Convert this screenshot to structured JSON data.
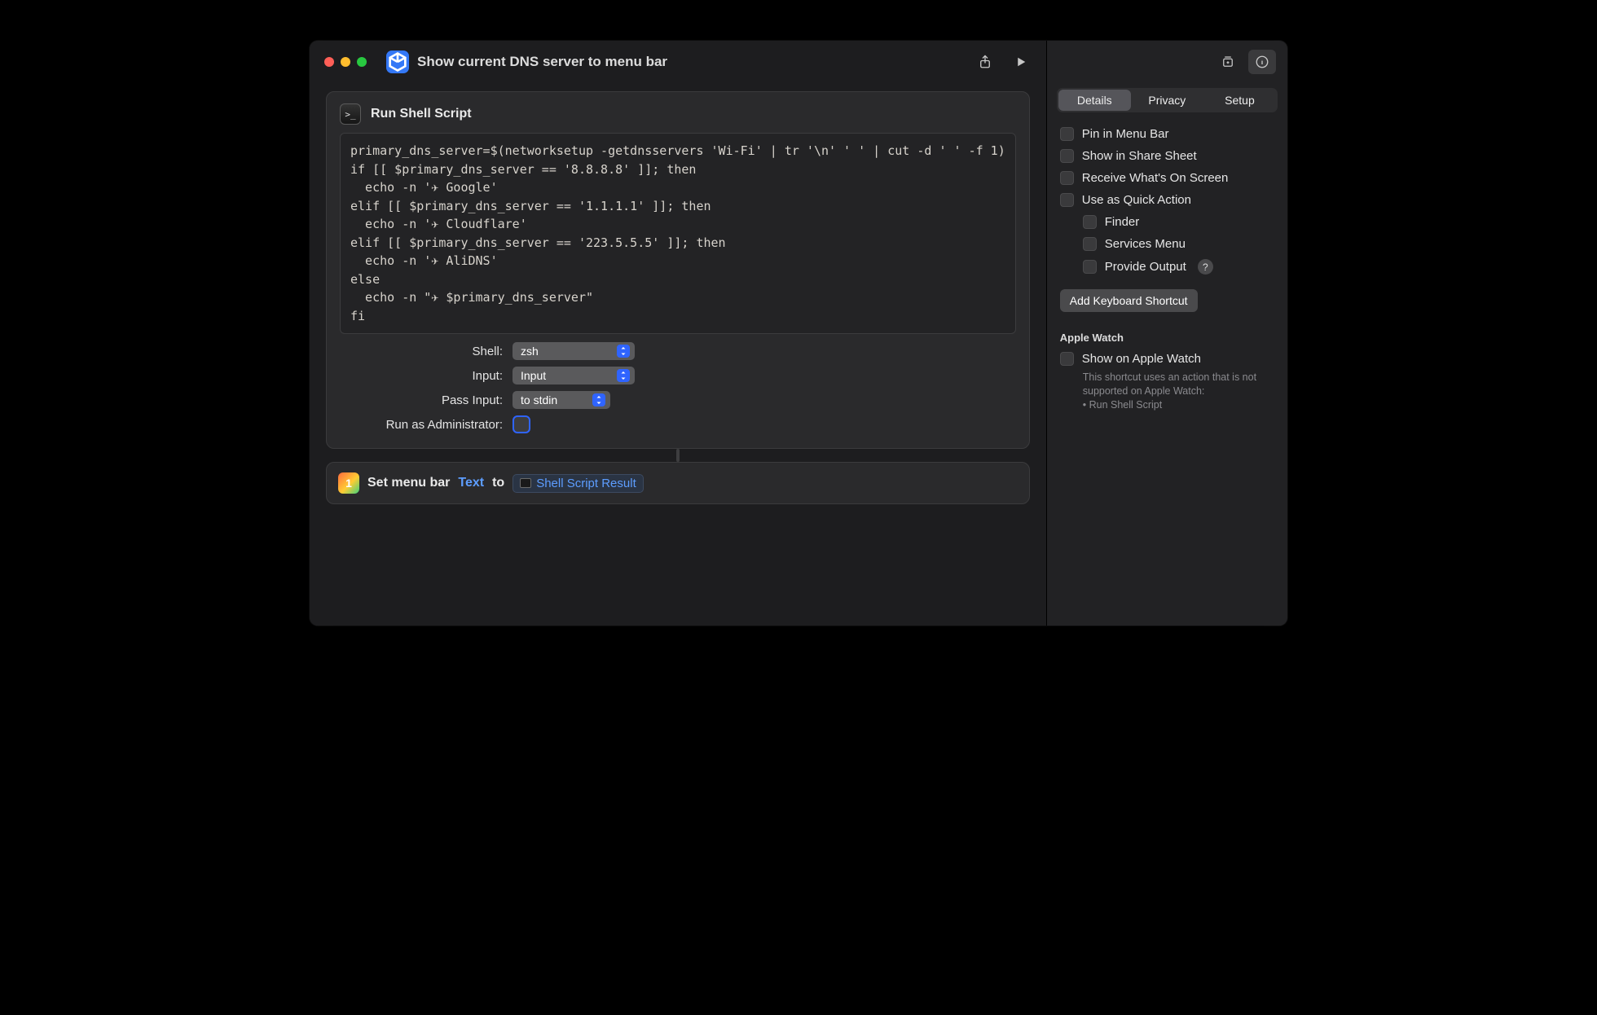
{
  "header": {
    "title": "Show current DNS server to menu bar"
  },
  "actions": {
    "shell": {
      "title": "Run Shell Script",
      "code": "primary_dns_server=$(networksetup -getdnsservers 'Wi-Fi' | tr '\\n' ' ' | cut -d ' ' -f 1)\nif [[ $primary_dns_server == '8.8.8.8' ]]; then\n  echo -n '✈ Google'\nelif [[ $primary_dns_server == '1.1.1.1' ]]; then\n  echo -n '✈ Cloudflare'\nelif [[ $primary_dns_server == '223.5.5.5' ]]; then\n  echo -n '✈ AliDNS'\nelse\n  echo -n \"✈ $primary_dns_server\"\nfi",
      "params": {
        "shell_label": "Shell:",
        "shell_value": "zsh",
        "input_label": "Input:",
        "input_value": "Input",
        "pass_label": "Pass Input:",
        "pass_value": "to stdin",
        "admin_label": "Run as Administrator:"
      }
    },
    "menubar": {
      "title": "Set menu bar",
      "token1": "Text",
      "to": "to",
      "token2": "Shell Script Result",
      "icon_glyph": "1"
    }
  },
  "sidebar": {
    "tabs": {
      "details": "Details",
      "privacy": "Privacy",
      "setup": "Setup"
    },
    "checks": {
      "pin": "Pin in Menu Bar",
      "share": "Show in Share Sheet",
      "receive": "Receive What's On Screen",
      "quick": "Use as Quick Action",
      "finder": "Finder",
      "services": "Services Menu",
      "provide": "Provide Output"
    },
    "add_shortcut": "Add Keyboard Shortcut",
    "watch_section": "Apple Watch",
    "watch_check": "Show on Apple Watch",
    "watch_hint": "This shortcut uses an action that is not supported on Apple Watch:\n• Run Shell Script"
  }
}
